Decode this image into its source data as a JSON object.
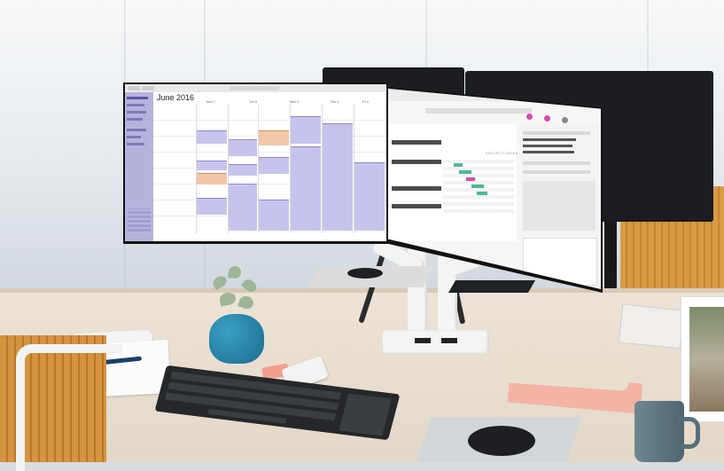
{
  "calendar": {
    "month_title": "June 2016",
    "day_headers": [
      "Mon 7",
      "Tue 8",
      "Wed 9",
      "Thu 4",
      "Fri 6"
    ]
  },
  "project": {
    "chart_title": "PROJECT DATES"
  },
  "colors": {
    "calendar_event": "#c7c4ec",
    "calendar_event_alt": "#f1c7a8",
    "calendar_sidebar": "#b6b3da",
    "gantt_bar": "#4cb89a",
    "gantt_highlight": "#d84aa8",
    "vase": "#2a86aa",
    "chair": "#d4943f"
  }
}
